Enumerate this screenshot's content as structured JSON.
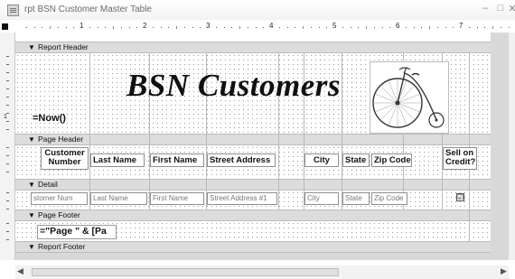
{
  "window": {
    "title": "rpt BSN Customer Master Table",
    "minimize": "–",
    "maximize": "□",
    "close": "✕"
  },
  "ruler": {
    "numbers": [
      "1",
      "2",
      "3",
      "4",
      "5",
      "6",
      "7"
    ]
  },
  "vruler": {
    "numbers": [
      "1"
    ]
  },
  "sections": {
    "report_header": "Report Header",
    "page_header": "Page Header",
    "detail": "Detail",
    "page_footer": "Page Footer",
    "report_footer": "Report Footer"
  },
  "report_header": {
    "title": "BSN Customers",
    "now_expr": "=Now()",
    "logo_icon": "penny-farthing-bicycle-image"
  },
  "page_header": {
    "labels": [
      "Customer Number",
      "Last Name",
      "First Name",
      "Street Address",
      "City",
      "State",
      "Zip Code",
      "Sell on Credit?"
    ],
    "customer_number_l1": "Customer",
    "customer_number_l2": "Number",
    "sell_credit_l1": "Sell on",
    "sell_credit_l2": "Credit?"
  },
  "detail": {
    "fields": [
      "stomer Num",
      "Last Name",
      "First Name",
      "Street Address #1",
      "City",
      "State",
      "Zip Code"
    ],
    "credit_checkbox": "☑"
  },
  "page_footer": {
    "expr": "=\"Page \" & [Pa"
  },
  "colors": {
    "band": "#dcdcdc",
    "grid_dot": "#9a9a9a",
    "title_text": "#6b6b6b"
  }
}
